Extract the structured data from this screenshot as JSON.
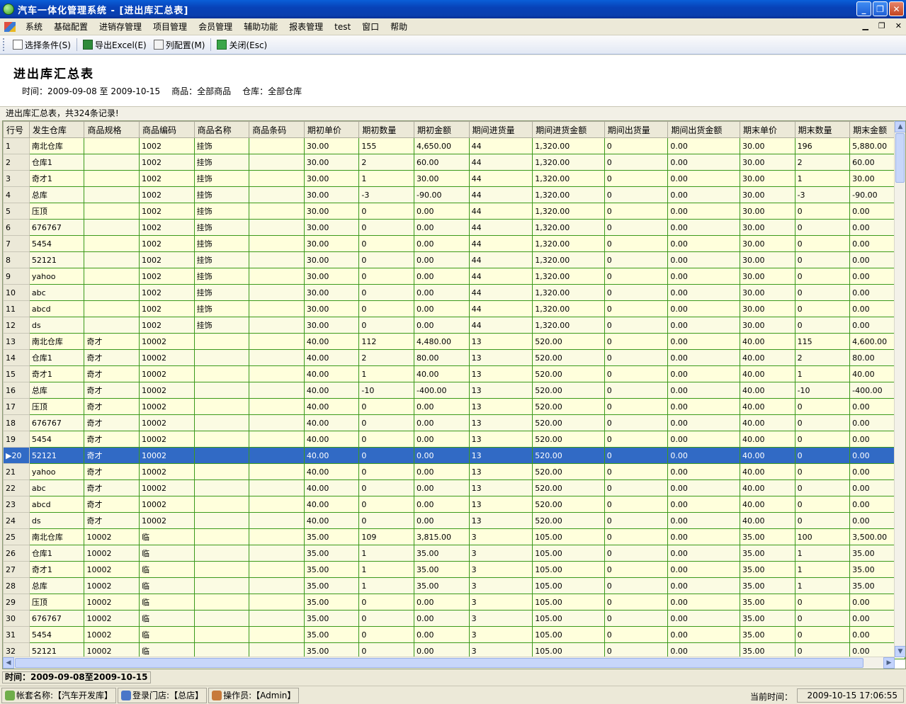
{
  "window": {
    "title": "汽车一体化管理系统 - [进出库汇总表]"
  },
  "menu": {
    "items": [
      "系统",
      "基础配置",
      "进销存管理",
      "项目管理",
      "会员管理",
      "辅助功能",
      "报表管理",
      "test",
      "窗口",
      "帮助"
    ]
  },
  "toolbar": {
    "select_label": "选择条件(S)",
    "export_label": "导出Excel(E)",
    "columns_label": "列配置(M)",
    "close_label": "关闭(Esc)"
  },
  "report": {
    "title": "进出库汇总表",
    "time": "时间：2009-09-08 至 2009-10-15",
    "goods": "商品：全部商品",
    "warehouse": "仓库：全部仓库"
  },
  "caption": "进出库汇总表，共324条记录!",
  "grid": {
    "columns": [
      "行号",
      "发生仓库",
      "商品规格",
      "商品编码",
      "商品名称",
      "商品条码",
      "期初单价",
      "期初数量",
      "期初金额",
      "期间进货量",
      "期间进货金额",
      "期间出货量",
      "期间出货金额",
      "期末单价",
      "期末数量",
      "期末金额"
    ],
    "selected_row": 20,
    "rows": [
      [
        "1",
        "南北仓库",
        "",
        "1002",
        "挂饰",
        "",
        "30.00",
        "155",
        "4,650.00",
        "44",
        "1,320.00",
        "0",
        "0.00",
        "30.00",
        "196",
        "5,880.00"
      ],
      [
        "2",
        "仓库1",
        "",
        "1002",
        "挂饰",
        "",
        "30.00",
        "2",
        "60.00",
        "44",
        "1,320.00",
        "0",
        "0.00",
        "30.00",
        "2",
        "60.00"
      ],
      [
        "3",
        "奇才1",
        "",
        "1002",
        "挂饰",
        "",
        "30.00",
        "1",
        "30.00",
        "44",
        "1,320.00",
        "0",
        "0.00",
        "30.00",
        "1",
        "30.00"
      ],
      [
        "4",
        "总库",
        "",
        "1002",
        "挂饰",
        "",
        "30.00",
        "-3",
        "-90.00",
        "44",
        "1,320.00",
        "0",
        "0.00",
        "30.00",
        "-3",
        "-90.00"
      ],
      [
        "5",
        "压顶",
        "",
        "1002",
        "挂饰",
        "",
        "30.00",
        "0",
        "0.00",
        "44",
        "1,320.00",
        "0",
        "0.00",
        "30.00",
        "0",
        "0.00"
      ],
      [
        "6",
        "676767",
        "",
        "1002",
        "挂饰",
        "",
        "30.00",
        "0",
        "0.00",
        "44",
        "1,320.00",
        "0",
        "0.00",
        "30.00",
        "0",
        "0.00"
      ],
      [
        "7",
        "5454",
        "",
        "1002",
        "挂饰",
        "",
        "30.00",
        "0",
        "0.00",
        "44",
        "1,320.00",
        "0",
        "0.00",
        "30.00",
        "0",
        "0.00"
      ],
      [
        "8",
        "52121",
        "",
        "1002",
        "挂饰",
        "",
        "30.00",
        "0",
        "0.00",
        "44",
        "1,320.00",
        "0",
        "0.00",
        "30.00",
        "0",
        "0.00"
      ],
      [
        "9",
        "yahoo",
        "",
        "1002",
        "挂饰",
        "",
        "30.00",
        "0",
        "0.00",
        "44",
        "1,320.00",
        "0",
        "0.00",
        "30.00",
        "0",
        "0.00"
      ],
      [
        "10",
        "abc",
        "",
        "1002",
        "挂饰",
        "",
        "30.00",
        "0",
        "0.00",
        "44",
        "1,320.00",
        "0",
        "0.00",
        "30.00",
        "0",
        "0.00"
      ],
      [
        "11",
        "abcd",
        "",
        "1002",
        "挂饰",
        "",
        "30.00",
        "0",
        "0.00",
        "44",
        "1,320.00",
        "0",
        "0.00",
        "30.00",
        "0",
        "0.00"
      ],
      [
        "12",
        "ds",
        "",
        "1002",
        "挂饰",
        "",
        "30.00",
        "0",
        "0.00",
        "44",
        "1,320.00",
        "0",
        "0.00",
        "30.00",
        "0",
        "0.00"
      ],
      [
        "13",
        "南北仓库",
        "奇才",
        "10002",
        "",
        "",
        "40.00",
        "112",
        "4,480.00",
        "13",
        "520.00",
        "0",
        "0.00",
        "40.00",
        "115",
        "4,600.00"
      ],
      [
        "14",
        "仓库1",
        "奇才",
        "10002",
        "",
        "",
        "40.00",
        "2",
        "80.00",
        "13",
        "520.00",
        "0",
        "0.00",
        "40.00",
        "2",
        "80.00"
      ],
      [
        "15",
        "奇才1",
        "奇才",
        "10002",
        "",
        "",
        "40.00",
        "1",
        "40.00",
        "13",
        "520.00",
        "0",
        "0.00",
        "40.00",
        "1",
        "40.00"
      ],
      [
        "16",
        "总库",
        "奇才",
        "10002",
        "",
        "",
        "40.00",
        "-10",
        "-400.00",
        "13",
        "520.00",
        "0",
        "0.00",
        "40.00",
        "-10",
        "-400.00"
      ],
      [
        "17",
        "压顶",
        "奇才",
        "10002",
        "",
        "",
        "40.00",
        "0",
        "0.00",
        "13",
        "520.00",
        "0",
        "0.00",
        "40.00",
        "0",
        "0.00"
      ],
      [
        "18",
        "676767",
        "奇才",
        "10002",
        "",
        "",
        "40.00",
        "0",
        "0.00",
        "13",
        "520.00",
        "0",
        "0.00",
        "40.00",
        "0",
        "0.00"
      ],
      [
        "19",
        "5454",
        "奇才",
        "10002",
        "",
        "",
        "40.00",
        "0",
        "0.00",
        "13",
        "520.00",
        "0",
        "0.00",
        "40.00",
        "0",
        "0.00"
      ],
      [
        "20",
        "52121",
        "奇才",
        "10002",
        "",
        "",
        "40.00",
        "0",
        "0.00",
        "13",
        "520.00",
        "0",
        "0.00",
        "40.00",
        "0",
        "0.00"
      ],
      [
        "21",
        "yahoo",
        "奇才",
        "10002",
        "",
        "",
        "40.00",
        "0",
        "0.00",
        "13",
        "520.00",
        "0",
        "0.00",
        "40.00",
        "0",
        "0.00"
      ],
      [
        "22",
        "abc",
        "奇才",
        "10002",
        "",
        "",
        "40.00",
        "0",
        "0.00",
        "13",
        "520.00",
        "0",
        "0.00",
        "40.00",
        "0",
        "0.00"
      ],
      [
        "23",
        "abcd",
        "奇才",
        "10002",
        "",
        "",
        "40.00",
        "0",
        "0.00",
        "13",
        "520.00",
        "0",
        "0.00",
        "40.00",
        "0",
        "0.00"
      ],
      [
        "24",
        "ds",
        "奇才",
        "10002",
        "",
        "",
        "40.00",
        "0",
        "0.00",
        "13",
        "520.00",
        "0",
        "0.00",
        "40.00",
        "0",
        "0.00"
      ],
      [
        "25",
        "南北仓库",
        "10002",
        "临",
        "",
        "",
        "35.00",
        "109",
        "3,815.00",
        "3",
        "105.00",
        "0",
        "0.00",
        "35.00",
        "100",
        "3,500.00"
      ],
      [
        "26",
        "仓库1",
        "10002",
        "临",
        "",
        "",
        "35.00",
        "1",
        "35.00",
        "3",
        "105.00",
        "0",
        "0.00",
        "35.00",
        "1",
        "35.00"
      ],
      [
        "27",
        "奇才1",
        "10002",
        "临",
        "",
        "",
        "35.00",
        "1",
        "35.00",
        "3",
        "105.00",
        "0",
        "0.00",
        "35.00",
        "1",
        "35.00"
      ],
      [
        "28",
        "总库",
        "10002",
        "临",
        "",
        "",
        "35.00",
        "1",
        "35.00",
        "3",
        "105.00",
        "0",
        "0.00",
        "35.00",
        "1",
        "35.00"
      ],
      [
        "29",
        "压顶",
        "10002",
        "临",
        "",
        "",
        "35.00",
        "0",
        "0.00",
        "3",
        "105.00",
        "0",
        "0.00",
        "35.00",
        "0",
        "0.00"
      ],
      [
        "30",
        "676767",
        "10002",
        "临",
        "",
        "",
        "35.00",
        "0",
        "0.00",
        "3",
        "105.00",
        "0",
        "0.00",
        "35.00",
        "0",
        "0.00"
      ],
      [
        "31",
        "5454",
        "10002",
        "临",
        "",
        "",
        "35.00",
        "0",
        "0.00",
        "3",
        "105.00",
        "0",
        "0.00",
        "35.00",
        "0",
        "0.00"
      ],
      [
        "32",
        "52121",
        "10002",
        "临",
        "",
        "",
        "35.00",
        "0",
        "0.00",
        "3",
        "105.00",
        "0",
        "0.00",
        "35.00",
        "0",
        "0.00"
      ]
    ]
  },
  "filter": "时间：2009-09-08至2009-10-15",
  "status": {
    "account": "帐套名称:【汽车开发库】",
    "store": "登录门店:【总店】",
    "operator": "操作员:【Admin】",
    "time_label": "当前时间：",
    "time": "2009-10-15 17:06:55"
  },
  "colors": {
    "title_bar": "#0842b8",
    "grid_line": "#3c9a1c",
    "row_bg": "#ffffdc",
    "selection": "#316ac5"
  }
}
